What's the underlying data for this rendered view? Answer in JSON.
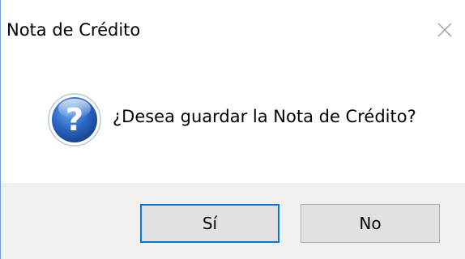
{
  "window": {
    "title": "Nota de Crédito"
  },
  "dialog": {
    "icon": "question-icon",
    "message": "¿Desea guardar la Nota de Crédito?"
  },
  "buttons": {
    "yes_label": "Sí",
    "no_label": "No"
  },
  "colors": {
    "footer_background": "#f0f0f0",
    "button_background": "#e1e1e1",
    "default_button_border": "#0078d7",
    "icon_blue": "#1f5fb4"
  }
}
